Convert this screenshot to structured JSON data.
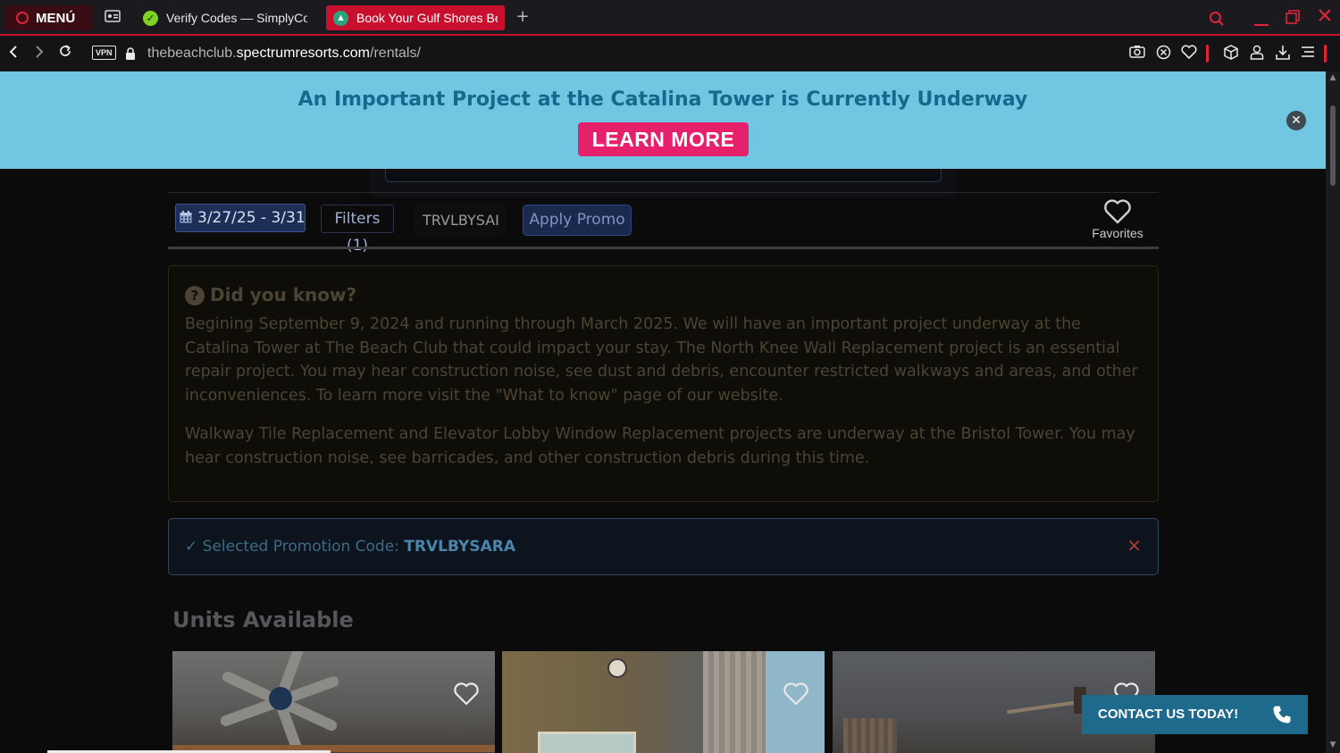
{
  "browser": {
    "menu_label": "MENÚ",
    "tabs": [
      {
        "title": "Verify Codes — SimplyCo"
      },
      {
        "title": "Book Your Gulf Shores Be"
      }
    ],
    "url_prefix": "thebeachclub.",
    "url_domain": "spectrumresorts.com",
    "url_path": "/rentals/",
    "vpn_label": "VPN",
    "accent_color": "#c8102e"
  },
  "banner": {
    "text": "An Important Project at the Catalina Tower is Currently Underway",
    "button_label": "LEARN MORE",
    "bg_color": "#71c7e2",
    "button_color": "#e6206a"
  },
  "search_bar": {
    "date_range": "3/27/25 - 3/31/",
    "filters_label": "Filters (1)",
    "promo_code_value": "TRVLBYSAI",
    "apply_label": "Apply Promo",
    "favorites_label": "Favorites"
  },
  "did_you_know": {
    "title": "Did you know?",
    "paragraphs": [
      "Begining September 9, 2024 and running through March 2025. We will have an important project underway at the Catalina Tower at The Beach Club that could impact your stay. The North Knee Wall Replacement project is an essential repair project. You may hear construction noise, see dust and debris, encounter restricted walkways and areas, and other inconveniences. To learn more visit the \"What to know\" page of our website.",
      "Walkway Tile Replacement and Elevator Lobby Window Replacement projects are underway at the Bristol Tower. You may hear construction noise, see barricades, and other construction debris during this time."
    ]
  },
  "promotion": {
    "label": "Selected Promotion Code:",
    "code": "TRVLBYSARA"
  },
  "units": {
    "title": "Units Available"
  },
  "contact": {
    "label": "CONTACT US TODAY!"
  }
}
